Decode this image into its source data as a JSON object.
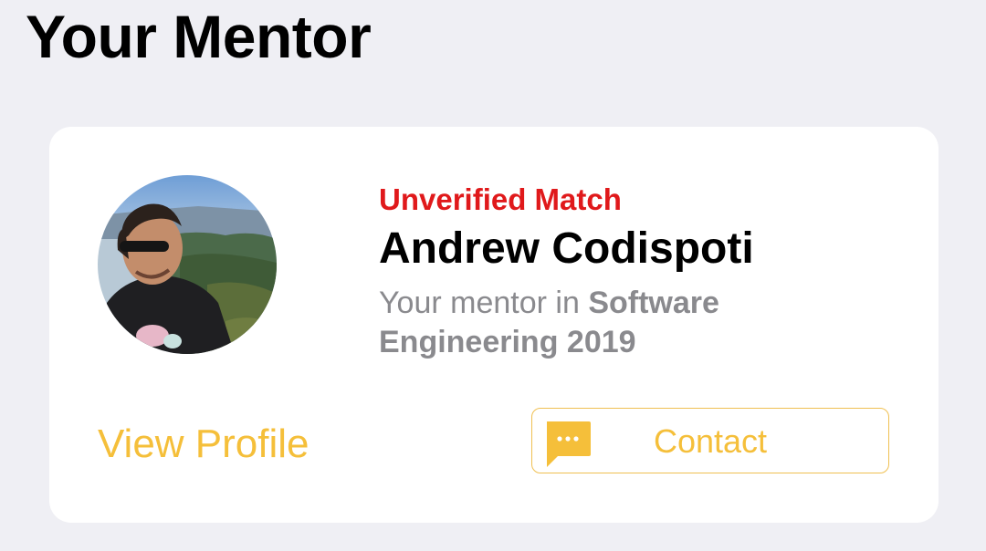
{
  "header": {
    "title": "Your Mentor"
  },
  "mentor_card": {
    "match_status": "Unverified Match",
    "name": "Andrew Codispoti",
    "description_prefix": "Your mentor in",
    "program": "Software Engineering 2019",
    "avatar_icon": "mentor-avatar-photo",
    "view_profile_label": "View Profile",
    "contact_label": "Contact",
    "contact_icon": "chat-bubble-icon"
  },
  "colors": {
    "background": "#efeff4",
    "card": "#ffffff",
    "status_red": "#e0191b",
    "accent_yellow": "#f5bf3a",
    "muted_text": "#8a8a8e"
  }
}
